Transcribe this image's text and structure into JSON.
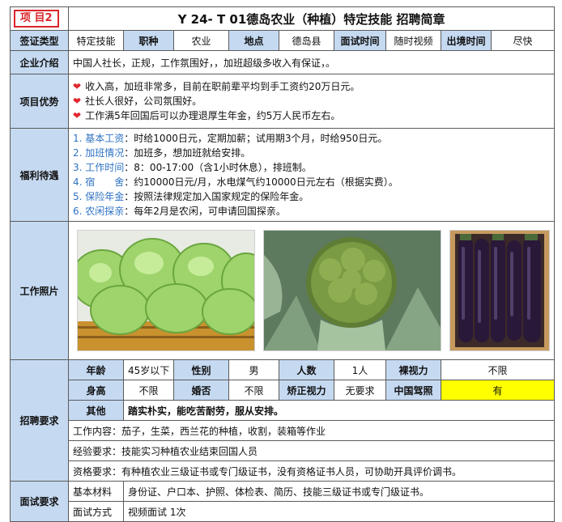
{
  "badge": "项 目2",
  "title": "Y 24- T 01德岛农业（种植）特定技能  招聘简章",
  "row1": {
    "visa_label": "签证类型",
    "visa_value": "特定技能",
    "job_label": "职种",
    "job_value": "农业",
    "place_label": "地点",
    "place_value": "德岛县",
    "interview_label": "面试时间",
    "interview_value": "随时视频",
    "depart_label": "出境时间",
    "depart_value": "尽快"
  },
  "company": {
    "label": "企业介绍",
    "text": "中国人社长，正规，工作氛围好，，加班超级多收入有保证，。"
  },
  "advantages": {
    "label": "项目优势",
    "items": [
      "收入高，加班非常多，目前在职前辈平均到手工资约20万日元。",
      "社长人很好，公司氛围好。",
      "工作满5年回国后可以办理退厚生年金，约5万人民币左右。"
    ]
  },
  "benefits": {
    "label": "福利待遇",
    "items": [
      {
        "num": "1.",
        "name": "基本工资",
        "text": "：时给1000日元，定期加薪；试用期3个月，时给950日元。"
      },
      {
        "num": "2.",
        "name": "加班情况",
        "text": "：加班多，想加班就给安排。"
      },
      {
        "num": "3.",
        "name": "工作时间",
        "text": "：8：00-17:00（含1小时休息），排班制。"
      },
      {
        "num": "4.",
        "name": "宿　　舍",
        "text": "：约10000日元/月，水电煤气约10000日元左右（根据实费）。"
      },
      {
        "num": "5.",
        "name": "保险年金",
        "text": "：按照法律规定加入国家规定的保险年金。"
      },
      {
        "num": "6.",
        "name": "农闲探亲",
        "text": "：每年2月是农闲，可申请回国探亲。"
      }
    ]
  },
  "photos": {
    "label": "工作照片",
    "images": [
      {
        "name": "cabbage-photo"
      },
      {
        "name": "broccoli-photo"
      },
      {
        "name": "eggplant-photo"
      }
    ]
  },
  "requirements": {
    "label": "招聘要求",
    "age_label": "年龄",
    "age_value": "45岁以下",
    "gender_label": "性别",
    "gender_value": "男",
    "count_label": "人数",
    "count_value": "1人",
    "vision_label": "裸视力",
    "vision_value": "不限",
    "height_label": "身高",
    "height_value": "不限",
    "marriage_label": "婚否",
    "marriage_value": "不限",
    "corrected_label": "矫正视力",
    "corrected_value": "无要求",
    "license_label": "中国驾照",
    "license_value": "有",
    "other_label": "其他",
    "other_value": "踏实朴实，能吃苦耐劳，服从安排。",
    "content": "工作内容：茄子，生菜，西兰花的种植，收割，装箱等作业",
    "experience": "经验要求：技能实习种植农业结束回国人员",
    "qualification": "资格要求：有种植农业三级证书或专门级证书，没有资格证书人员，可协助开具评价调书。"
  },
  "interview": {
    "label": "面试要求",
    "materials_label": "基本材料",
    "materials_value": "身份证、户口本、护照、体检表、简历、技能三级证书或专门级证书。",
    "method_label": "面试方式",
    "method_value": "视频面试 1次"
  },
  "colors": {
    "header_bg": "#c5d9f1",
    "badge": "#d9262b",
    "highlight": "#ffff00",
    "heart": "#e0282e",
    "label_blue": "#2f73c4"
  }
}
